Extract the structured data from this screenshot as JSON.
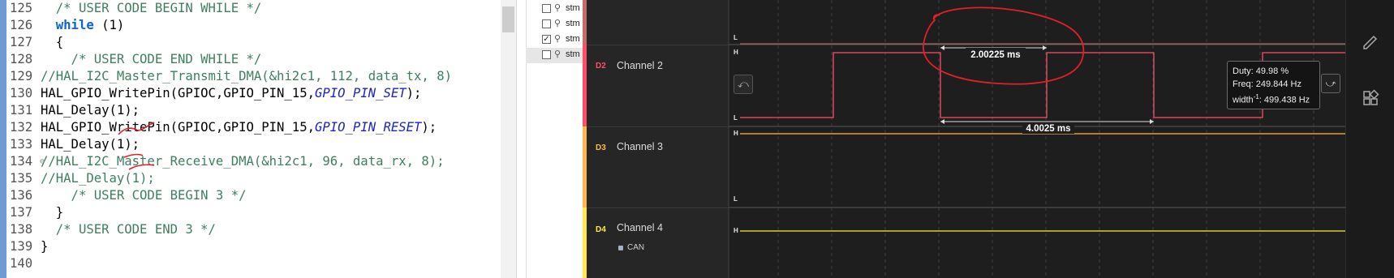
{
  "editor": {
    "lines": [
      {
        "num": "125",
        "text": "  /* USER CODE BEGIN WHILE */"
      },
      {
        "num": "126",
        "kw": "while",
        "rest": " (1)"
      },
      {
        "num": "127",
        "text": "  {"
      },
      {
        "num": "128",
        "text": "    /* USER CODE END WHILE */"
      },
      {
        "num": "129",
        "text": "//HAL_I2C_Master_Transmit_DMA(&hi2c1, 112, data_tx, 8)"
      },
      {
        "num": "130",
        "pre": "HAL_GPIO_WritePin(GPIOC,GPIO_PIN_15,",
        "con": "GPIO_PIN_SET",
        "post": ");"
      },
      {
        "num": "131",
        "text": "HAL_Delay(1);"
      },
      {
        "num": "132",
        "pre": "HAL_GPIO_WritePin(GPIOC,GPIO_PIN_15,",
        "con": "GPIO_PIN_RESET",
        "post": ");"
      },
      {
        "num": "133",
        "text": "HAL_Delay(1);"
      },
      {
        "num": "134",
        "text": "//HAL_I2C_Master_Receive_DMA(&hi2c1, 96, data_rx, 8);"
      },
      {
        "num": "135",
        "text": "//HAL_Delay(1);"
      },
      {
        "num": "136",
        "text": "    /* USER CODE BEGIN 3 */"
      },
      {
        "num": "137",
        "text": "  }"
      },
      {
        "num": "138",
        "text": "  /* USER CODE END 3 */"
      },
      {
        "num": "139",
        "text": "}"
      },
      {
        "num": "140",
        "text": ""
      }
    ],
    "fold_marker": "⊖"
  },
  "signal_list": {
    "items": [
      {
        "label": "stm",
        "checked": false
      },
      {
        "label": "stm",
        "checked": false
      },
      {
        "label": "stm",
        "checked": true
      },
      {
        "label": "stm",
        "checked": false
      }
    ]
  },
  "analyzer": {
    "channels": [
      {
        "id": "D2",
        "name": "Channel 2",
        "color": "#ff4d6a"
      },
      {
        "id": "D3",
        "name": "Channel 3",
        "color": "#ffb74d"
      },
      {
        "id": "D4",
        "name": "Channel 4",
        "color": "#ffe94d"
      }
    ],
    "level_high": "H",
    "level_low": "L",
    "measure_width": "2.00225 ms",
    "measure_period": "4.0025 ms",
    "can_label": "CAN",
    "tooltip": {
      "duty": "Duty: 49.98 %",
      "freq": "Freq: 249.844 Hz",
      "width_prefix": "width",
      "width_exp": "-1",
      "width_value": ": 499.438 Hz"
    },
    "colors": {
      "background": "#1e1e1e",
      "ch2_wave": "#ff4d6a",
      "ch3_wave": "#ffb74d",
      "ch4_wave": "#ffe94d",
      "annotation": "#e0202a"
    }
  }
}
